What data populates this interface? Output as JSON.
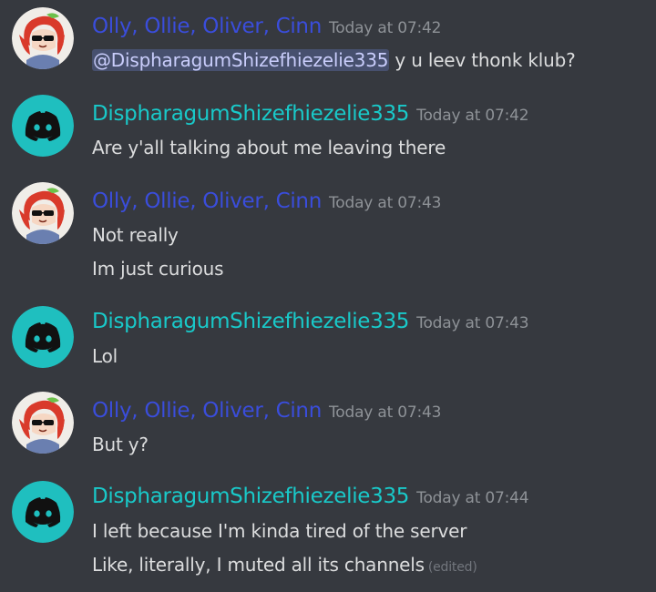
{
  "colors": {
    "background": "#36393f",
    "author_olly": "#3a4ddb",
    "author_dispharagum": "#19c9c9",
    "timestamp": "#8e9297",
    "text": "#dcddde",
    "mention_bg": "#4f5b93"
  },
  "messages": [
    {
      "author": "Olly, Ollie, Oliver, Cinn",
      "timestamp": "Today at 07:42",
      "avatar_icon": "anime-character-sunglasses-avatar",
      "mention": "@DispharagumShizefhiezelie335",
      "lines": [
        " y u leev thonk klub?"
      ]
    },
    {
      "author": "DispharagumShizefhiezelie335",
      "timestamp": "Today at 07:42",
      "avatar_icon": "discord-logo-avatar",
      "lines": [
        "Are y'all talking about me leaving there"
      ]
    },
    {
      "author": "Olly, Ollie, Oliver, Cinn",
      "timestamp": "Today at 07:43",
      "avatar_icon": "anime-character-sunglasses-avatar",
      "lines": [
        "Not really",
        "Im just curious"
      ]
    },
    {
      "author": "DispharagumShizefhiezelie335",
      "timestamp": "Today at 07:43",
      "avatar_icon": "discord-logo-avatar",
      "lines": [
        "Lol"
      ]
    },
    {
      "author": "Olly, Ollie, Oliver, Cinn",
      "timestamp": "Today at 07:43",
      "avatar_icon": "anime-character-sunglasses-avatar",
      "lines": [
        "But y?"
      ]
    },
    {
      "author": "DispharagumShizefhiezelie335",
      "timestamp": "Today at 07:44",
      "avatar_icon": "discord-logo-avatar",
      "lines": [
        "I left because I'm kinda tired of the server",
        "Like, literally, I muted all its channels"
      ],
      "edited_label": "(edited)"
    }
  ]
}
